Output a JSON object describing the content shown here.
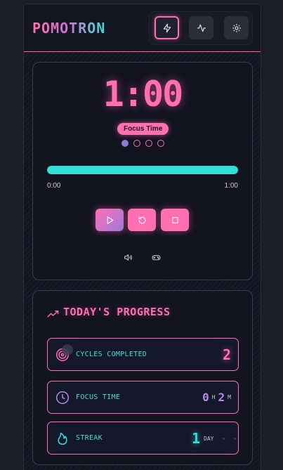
{
  "header": {
    "logo": "POMOTRON",
    "icons": [
      "lightning-icon",
      "activity-icon",
      "gear-icon"
    ]
  },
  "timer": {
    "display": "1:00",
    "mode": "Focus Time",
    "sessions_total": 4,
    "sessions_done": 1,
    "progress": 1.0,
    "elapsed_label": "0:00",
    "total_label": "1:00"
  },
  "controls": {
    "buttons": [
      "play-icon",
      "reset-icon",
      "stop-icon"
    ],
    "extras": [
      "volume-icon",
      "gamepad-icon"
    ]
  },
  "progress": {
    "title": "TODAY'S PROGRESS",
    "stats": {
      "cycles": {
        "label": "CYCLES COMPLETED",
        "value": "2"
      },
      "focus": {
        "label": "FOCUS TIME",
        "hours": "0",
        "hours_unit": "H",
        "minutes": "2",
        "minutes_unit": "M"
      },
      "streak": {
        "label": "STREAK",
        "value": "1",
        "unit": "DAY"
      }
    }
  },
  "colors": {
    "accent_pink": "#ff6fb1",
    "accent_cyan": "#2ee0d8",
    "accent_purple": "#9d7ae0",
    "background": "#121420"
  }
}
